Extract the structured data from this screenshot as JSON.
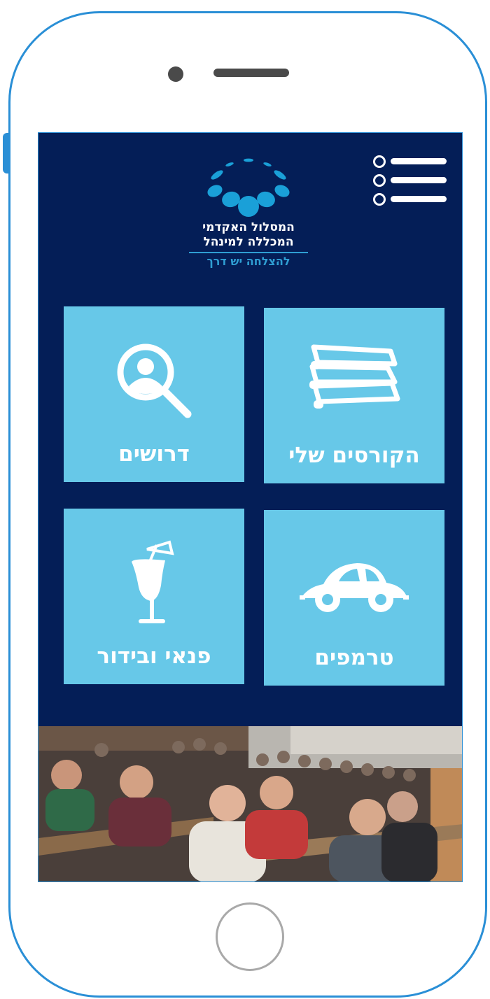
{
  "app": {
    "logo": {
      "line1": "המסלול האקדמי",
      "line2": "המכללה למינהל",
      "tagline": "להצלחה יש דרך",
      "color_dark": "#1aa0d8",
      "color_light": "#2f9ed3"
    },
    "menu_icon": "hamburger-list-icon",
    "tiles": [
      {
        "label": "הקורסים שלי",
        "icon": "books-icon"
      },
      {
        "label": "דרושים",
        "icon": "person-search-icon"
      },
      {
        "label": "טרמפים",
        "icon": "car-icon"
      },
      {
        "label": "פנאי ובידור",
        "icon": "cocktail-icon"
      }
    ],
    "banner_image": "lecture-hall-students-photo"
  },
  "theme": {
    "background": "#041e57",
    "tile": "#67c8e8",
    "frame": "#2a8fd6"
  }
}
